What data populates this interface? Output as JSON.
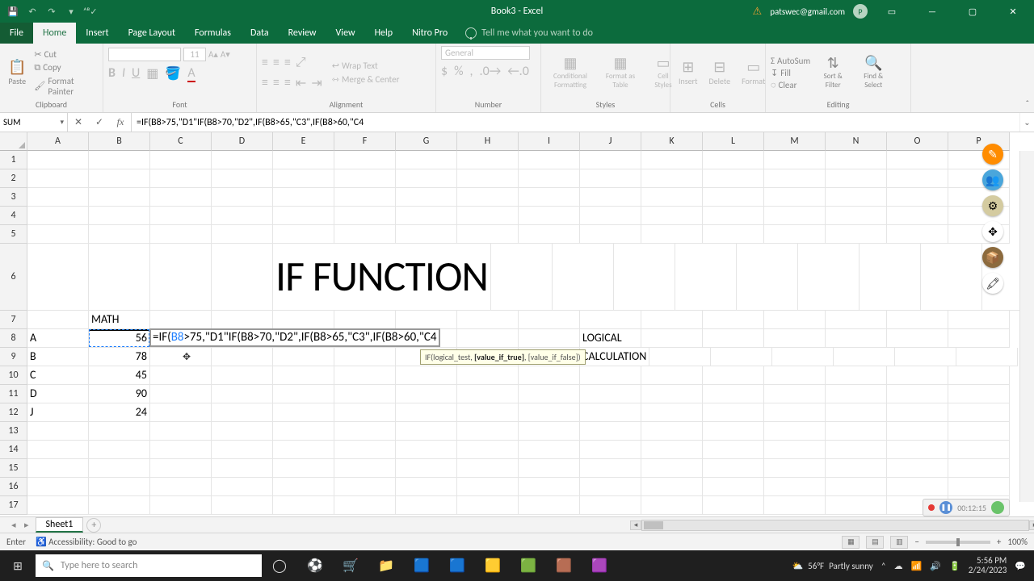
{
  "titlebar": {
    "doc_title": "Book3 - Excel",
    "email": "patswec@gmail.com",
    "avatar_initial": "P"
  },
  "tabs": {
    "file": "File",
    "home": "Home",
    "insert": "Insert",
    "page_layout": "Page Layout",
    "formulas": "Formulas",
    "data": "Data",
    "review": "Review",
    "view": "View",
    "help": "Help",
    "nitro": "Nitro Pro",
    "tell_me": "Tell me what you want to do"
  },
  "ribbon": {
    "clipboard": {
      "title": "Clipboard",
      "paste": "Paste",
      "cut": "Cut",
      "copy": "Copy",
      "painter": "Format Painter"
    },
    "font": {
      "title": "Font",
      "name_placeholder": "",
      "size": "11"
    },
    "alignment": {
      "title": "Alignment",
      "wrap": "Wrap Text",
      "merge": "Merge & Center"
    },
    "number_group": {
      "title": "Number",
      "format": "General"
    },
    "styles": {
      "title": "Styles",
      "cond": "Conditional Formatting",
      "fmt_table": "Format as Table",
      "cell_styles": "Cell Styles"
    },
    "cells_group": {
      "title": "Cells",
      "insert": "Insert",
      "delete": "Delete",
      "format": "Format"
    },
    "editing": {
      "title": "Editing",
      "autosum": "AutoSum",
      "fill": "Fill",
      "clear": "Clear",
      "sort": "Sort & Filter",
      "find": "Find & Select"
    }
  },
  "namebox": {
    "value": "SUM"
  },
  "formula_bar": {
    "value": "=IF(B8>75,\"D1\"IF(B8>70,\"D2\",IF(B8>65,\"C3\",IF(B8>60,\"C4"
  },
  "columns": [
    "A",
    "B",
    "C",
    "D",
    "E",
    "F",
    "G",
    "H",
    "I",
    "J",
    "K",
    "L",
    "M",
    "N",
    "O",
    "P"
  ],
  "row_numbers": [
    "1",
    "2",
    "3",
    "4",
    "5",
    "6",
    "7",
    "8",
    "9",
    "10",
    "11",
    "12",
    "13",
    "14",
    "15",
    "16",
    "17"
  ],
  "data_cells": {
    "title_r6": "IF FUNCTION",
    "b7": "MATH",
    "a8": "A",
    "b8": "56",
    "a9": "B",
    "b9": "78",
    "a10": "C",
    "b10": "45",
    "a11": "D",
    "b11": "90",
    "a12": "J",
    "b12": "24",
    "j8": "LOGICAL",
    "j9": "CALCULATION"
  },
  "edit_cell": {
    "prefix": "=IF(",
    "ref": "B8",
    "rest": ">75,\"D1\"IF(B8>70,\"D2\",IF(B8>65,\"C3\",IF(B8>60,\"C4"
  },
  "tooltip": {
    "fn": "IF(logical_test, ",
    "bold": "[value_if_true]",
    "tail": ", [value_if_false])"
  },
  "sheet_tabs": {
    "sheet1": "Sheet1"
  },
  "statusbar": {
    "mode": "Enter",
    "a11y": "Accessibility: Good to go",
    "zoom": "100%"
  },
  "rec": {
    "time": "00:12:15"
  },
  "taskbar": {
    "search_placeholder": "Type here to search",
    "weather_temp": "56°F",
    "weather_desc": "Partly sunny",
    "time": "5:56 PM",
    "date": "2/24/2023"
  }
}
